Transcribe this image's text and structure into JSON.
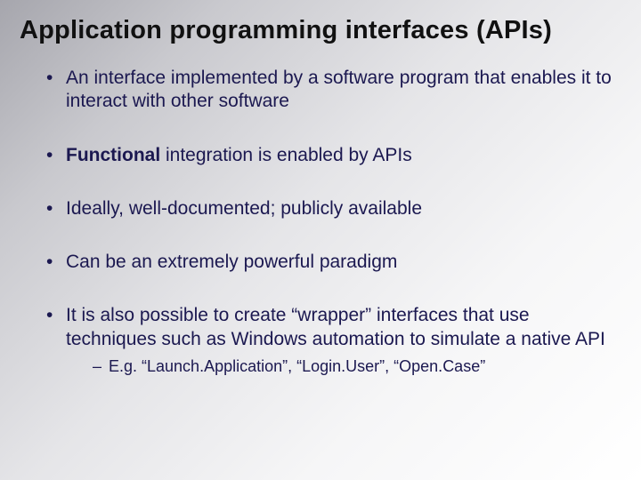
{
  "title": "Application programming interfaces (APIs)",
  "bullets": {
    "b0": "An interface implemented by a software program that enables it to interact with other software",
    "b1_bold": "Functional",
    "b1_rest": " integration is enabled by APIs",
    "b2": "Ideally, well-documented; publicly available",
    "b3": "Can be an extremely powerful paradigm",
    "b4": "It is also possible to create “wrapper” interfaces that use techniques such as Windows automation to simulate a native API",
    "b4_sub0": "E.g. “Launch.Application”, “Login.User”, “Open.Case”"
  }
}
